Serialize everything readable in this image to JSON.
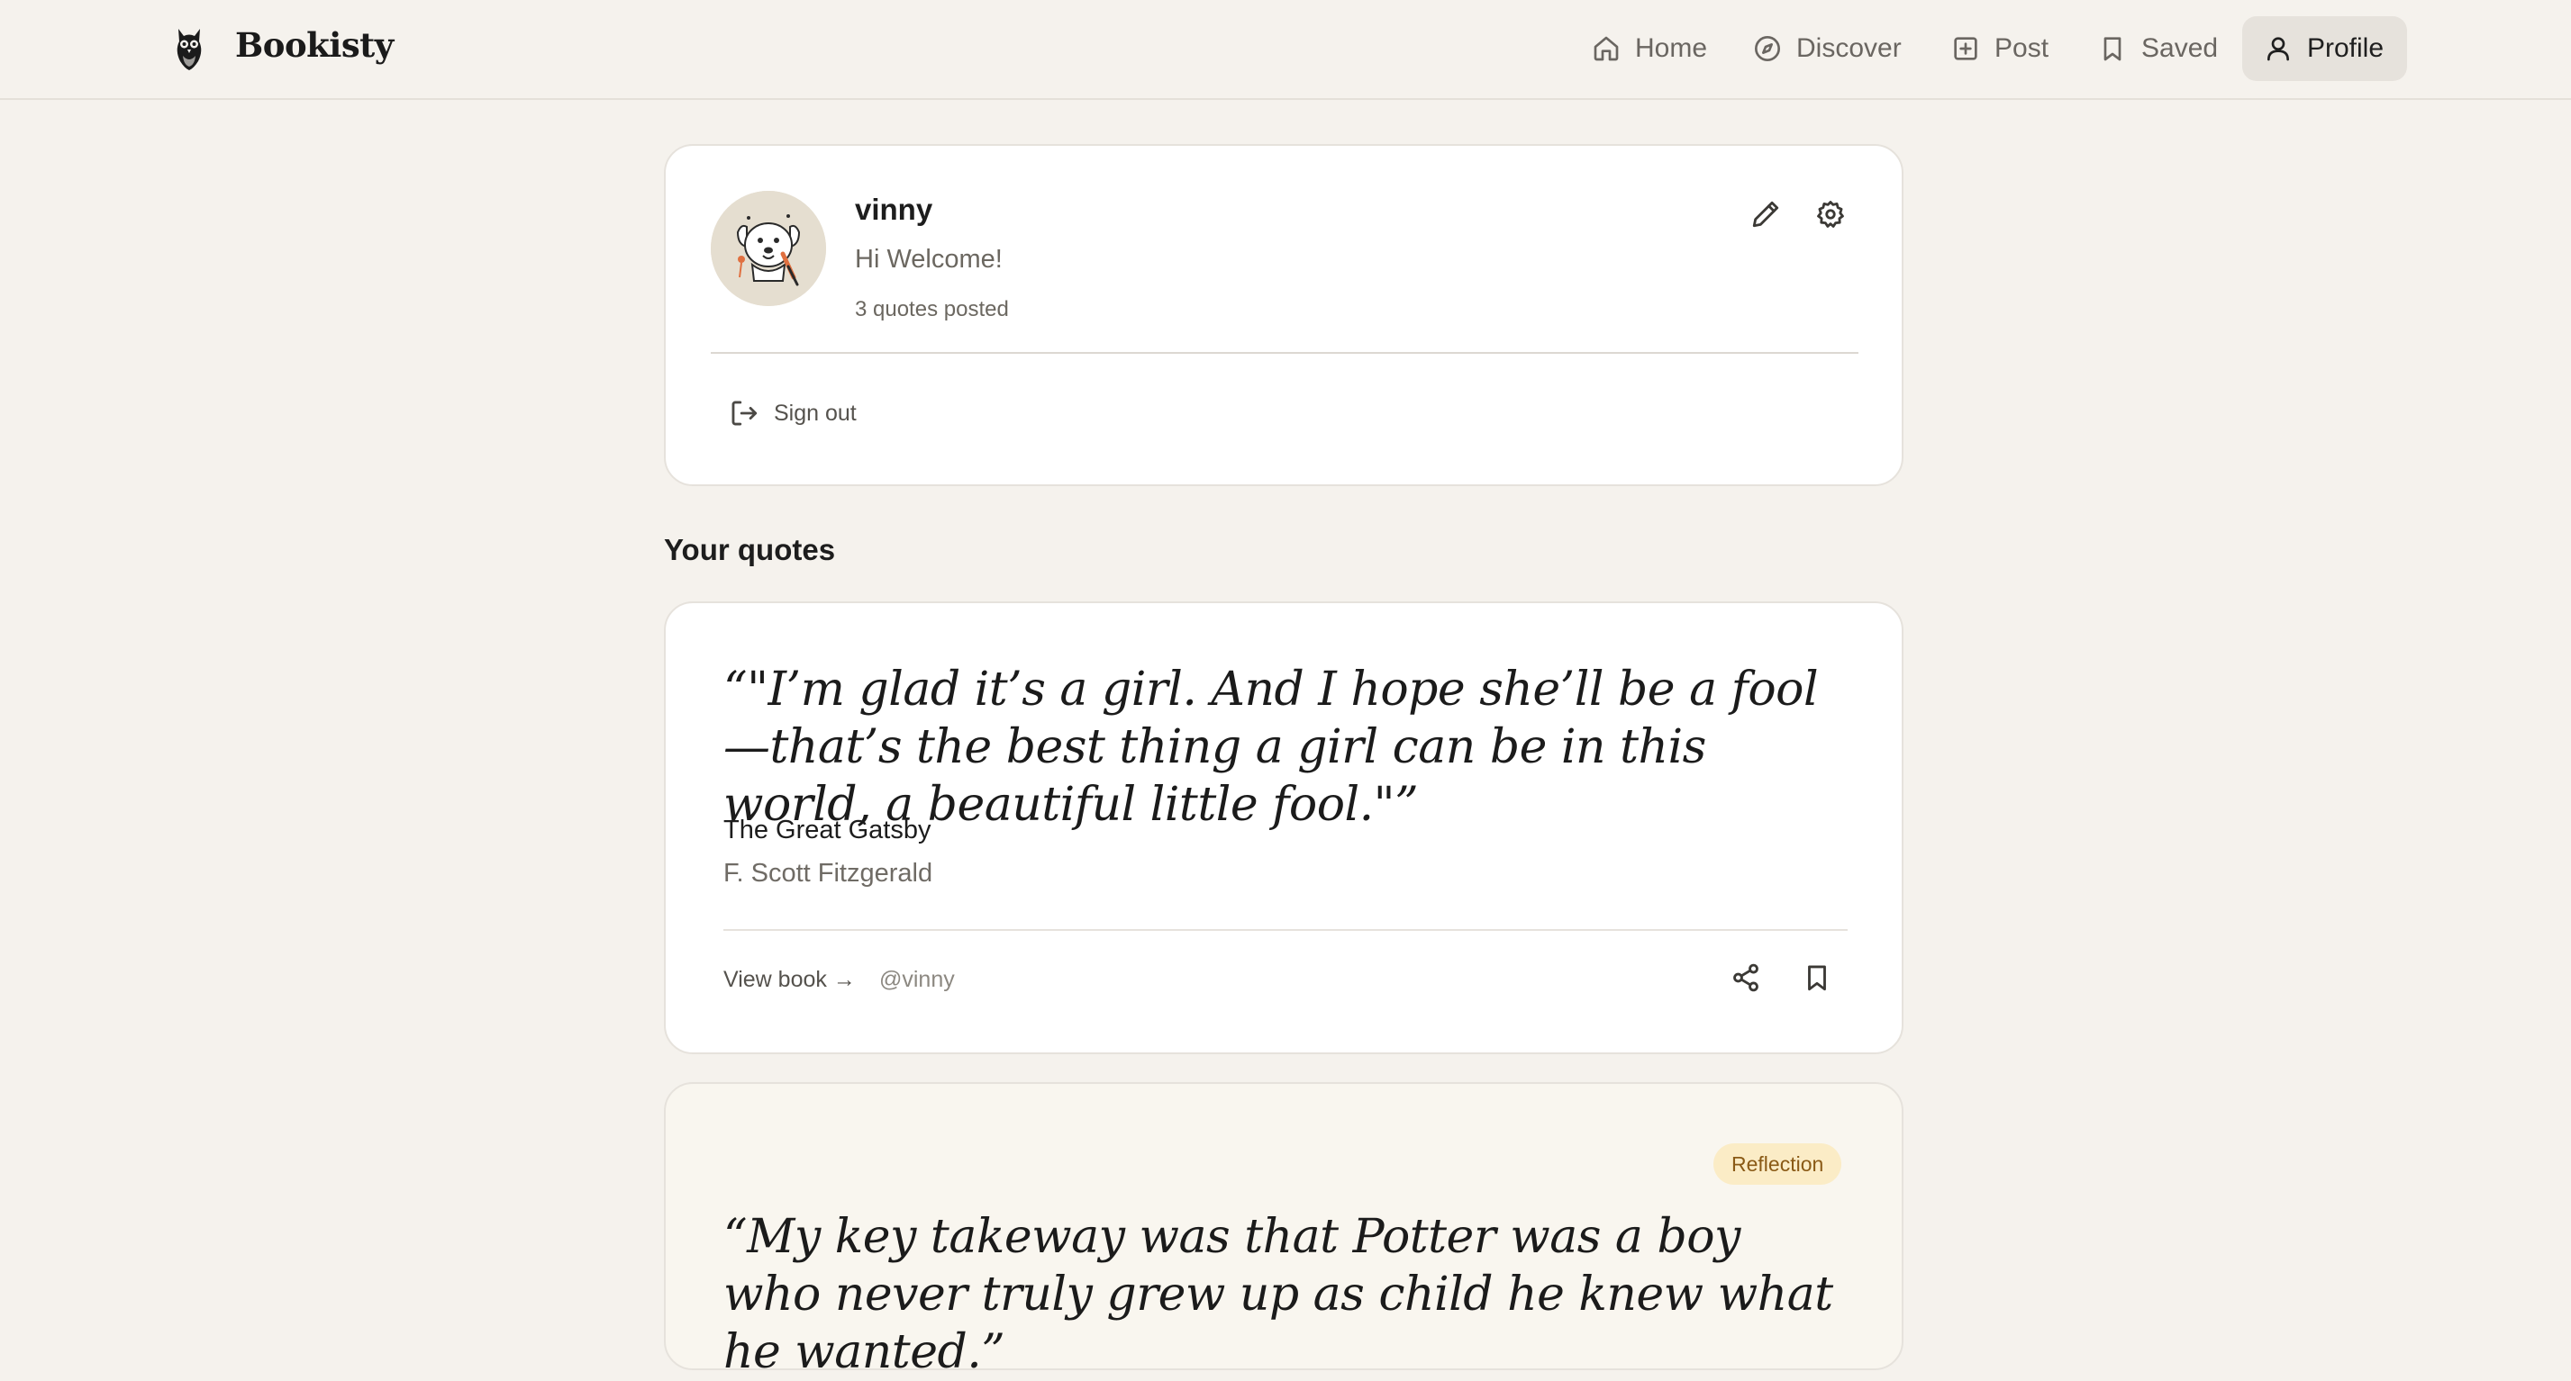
{
  "app": {
    "brand": "Bookisty"
  },
  "nav": {
    "items": [
      {
        "label": "Home",
        "icon": "home-icon"
      },
      {
        "label": "Discover",
        "icon": "compass-icon"
      },
      {
        "label": "Post",
        "icon": "plus-square-icon"
      },
      {
        "label": "Saved",
        "icon": "bookmark-icon"
      },
      {
        "label": "Profile",
        "icon": "user-icon",
        "active": true
      }
    ]
  },
  "profile": {
    "username": "vinny",
    "bio": "Hi Welcome!",
    "quote_count": "3 quotes posted",
    "sign_out_label": "Sign out"
  },
  "section_title": "Your quotes",
  "quotes": [
    {
      "text": "“\"I’m glad it’s a girl. And I hope she’ll be a fool—that’s the best thing a girl can be in this world, a beautiful little fool.\"”",
      "book": "The Great Gatsby",
      "author": "F. Scott Fitzgerald",
      "view_book_label": "View book →",
      "handle": "@vinny"
    },
    {
      "tag": "Reflection",
      "text": "“My key takeway was that Potter was a boy who never truly grew up as child he knew what he wanted.”"
    }
  ],
  "colors": {
    "background": "#f5f2ed",
    "card": "#ffffff",
    "active_nav": "#e6e2dc",
    "tag_bg": "#fbecc6",
    "tag_text": "#8a5a16"
  }
}
